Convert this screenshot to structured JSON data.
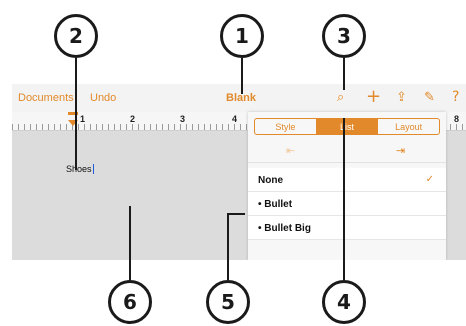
{
  "toolbar": {
    "documents_label": "Documents",
    "undo_label": "Undo",
    "title": "Blank",
    "icons": [
      "brush-icon",
      "plus-icon",
      "share-icon",
      "wrench-icon",
      "help-icon"
    ],
    "icon_glyphs": {
      "brush": "⌕",
      "plus": "+",
      "share": "⇪",
      "wrench": "✎",
      "help": "?"
    }
  },
  "ruler": {
    "numbers": [
      "1",
      "2",
      "3",
      "4",
      "8"
    ]
  },
  "document": {
    "text": "Shoes"
  },
  "popover": {
    "tabs": [
      "Style",
      "List",
      "Layout"
    ],
    "active_tab": "List",
    "indent_left_glyph": "⇤",
    "indent_right_glyph": "⇥",
    "items": [
      {
        "label": "None",
        "checked": true
      },
      {
        "label": "• Bullet",
        "checked": false
      },
      {
        "label": "• Bullet Big",
        "checked": false
      }
    ],
    "check_glyph": "✓"
  },
  "callouts": [
    "1",
    "2",
    "3",
    "4",
    "5",
    "6"
  ],
  "colors": {
    "accent": "#e28a2b",
    "canvas": "#dcdcdc",
    "callout": "#1a1a1a"
  }
}
